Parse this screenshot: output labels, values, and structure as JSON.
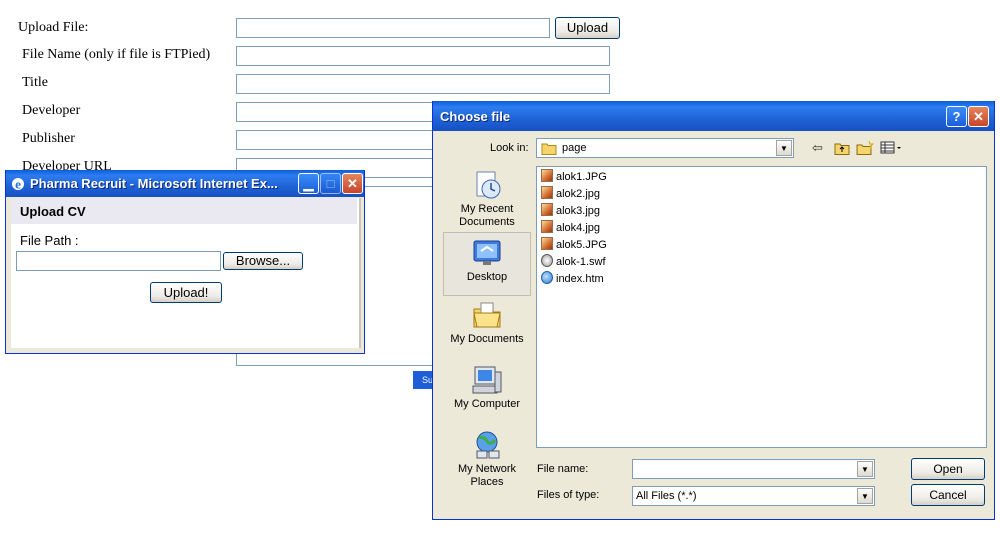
{
  "form": {
    "upload_file_label": "Upload File:",
    "upload_button": "Upload",
    "file_name_label": "File Name (only if file is FTPied)",
    "title_label": "Title",
    "developer_label": "Developer",
    "publisher_label": "Publisher",
    "developer_url_label": "Developer URL",
    "submit_label": "Su"
  },
  "ie_window": {
    "title": "Pharma Recruit - Microsoft Internet Ex...",
    "header": "Upload CV",
    "file_path_label": "File Path :",
    "file_path_value": "",
    "browse_button": "Browse...",
    "upload_button": "Upload!"
  },
  "dialog": {
    "title": "Choose file",
    "help_button": "?",
    "close_button": "✕",
    "look_in_label": "Look in:",
    "look_in_value": "page",
    "places": [
      {
        "label": "My Recent Documents",
        "icon": "recent-documents-icon"
      },
      {
        "label": "Desktop",
        "icon": "desktop-icon"
      },
      {
        "label": "My Documents",
        "icon": "my-documents-icon"
      },
      {
        "label": "My Computer",
        "icon": "my-computer-icon"
      },
      {
        "label": "My Network Places",
        "icon": "network-places-icon"
      }
    ],
    "files": [
      {
        "name": "alok1.JPG",
        "type": "jpg"
      },
      {
        "name": "alok2.jpg",
        "type": "jpg"
      },
      {
        "name": "alok3.jpg",
        "type": "jpg"
      },
      {
        "name": "alok4.jpg",
        "type": "jpg"
      },
      {
        "name": "alok5.JPG",
        "type": "jpg"
      },
      {
        "name": "alok-1.swf",
        "type": "swf"
      },
      {
        "name": "index.htm",
        "type": "htm"
      }
    ],
    "file_name_label": "File name:",
    "file_name_value": "",
    "files_of_type_label": "Files of type:",
    "files_of_type_value": "All Files (*.*)",
    "open_button": "Open",
    "cancel_button": "Cancel"
  }
}
